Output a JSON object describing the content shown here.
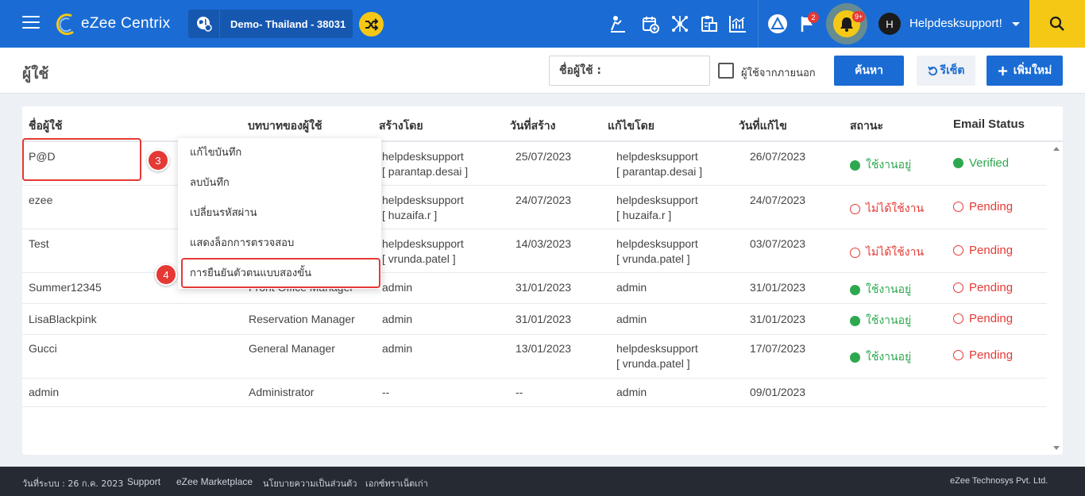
{
  "header": {
    "logo_text": "eZee Centrix",
    "property": "Demo- Thailand -  38031",
    "notif_flag_count": "2",
    "notif_bell_count": "9+",
    "avatar_letter": "H",
    "username": "Helpdesksupport!"
  },
  "page": {
    "title": "ผู้ใช้",
    "search_placeholder": "ชื่อผู้ใช้ :",
    "external_label": "ผู้ใช้จากภายนอก",
    "search_btn": "ค้นหา",
    "reset_btn": "รีเซ็ต",
    "add_btn": "เพิ่มใหม่"
  },
  "table": {
    "headers": [
      "ชื่อผู้ใช้",
      "บทบาทของผู้ใช้",
      "สร้างโดย",
      "วันที่สร้าง",
      "แก้ไขโดย",
      "วันที่แก้ไข",
      "สถานะ",
      "Email Status"
    ],
    "rows": [
      {
        "name": "P@D",
        "role": "",
        "created_by": "helpdesksupport",
        "created_by2": "[ parantap.desai ]",
        "created": "25/07/2023",
        "modified_by": "helpdesksupport",
        "modified_by2": "[ parantap.desai ]",
        "modified": "26/07/2023",
        "status": "ใช้งานอยู่",
        "email": "Verified"
      },
      {
        "name": "ezee",
        "role": "",
        "created_by": "helpdesksupport",
        "created_by2": "[ huzaifa.r ]",
        "created": "24/07/2023",
        "modified_by": "helpdesksupport",
        "modified_by2": "[ huzaifa.r ]",
        "modified": "24/07/2023",
        "status": "ไม่ได้ใช้งาน",
        "email": "Pending"
      },
      {
        "name": "Test",
        "role": "",
        "created_by": "helpdesksupport",
        "created_by2": "[ vrunda.patel ]",
        "created": "14/03/2023",
        "modified_by": "helpdesksupport",
        "modified_by2": "[ vrunda.patel ]",
        "modified": "03/07/2023",
        "status": "ไม่ได้ใช้งาน",
        "email": "Pending"
      },
      {
        "name": "Summer12345",
        "role": "Front Office Manager",
        "created_by": "admin",
        "created_by2": "",
        "created": "31/01/2023",
        "modified_by": "admin",
        "modified_by2": "",
        "modified": "31/01/2023",
        "status": "ใช้งานอยู่",
        "email": "Pending"
      },
      {
        "name": "LisaBlackpink",
        "role": "Reservation Manager",
        "created_by": "admin",
        "created_by2": "",
        "created": "31/01/2023",
        "modified_by": "admin",
        "modified_by2": "",
        "modified": "31/01/2023",
        "status": "ใช้งานอยู่",
        "email": "Pending"
      },
      {
        "name": "Gucci",
        "role": "General Manager",
        "created_by": "admin",
        "created_by2": "",
        "created": "13/01/2023",
        "modified_by": "helpdesksupport",
        "modified_by2": "[ vrunda.patel ]",
        "modified": "17/07/2023",
        "status": "ใช้งานอยู่",
        "email": "Pending"
      },
      {
        "name": "admin",
        "role": "Administrator",
        "created_by": "--",
        "created_by2": "",
        "created": "--",
        "modified_by": "admin",
        "modified_by2": "",
        "modified": "09/01/2023",
        "status": "",
        "email": ""
      }
    ]
  },
  "context_menu": {
    "items": [
      "แก้ไขบันทึก",
      "ลบบันทึก",
      "เปลี่ยนรหัสผ่าน",
      "แสดงล็อกการตรวจสอบ",
      "การยืนยันตัวตนแบบสองขั้น"
    ]
  },
  "steps": {
    "step3": "3",
    "step4": "4"
  },
  "footer": {
    "date": "วันที่ระบบ : 26 ก.ค. 2023",
    "support": "Support",
    "marketplace": "eZee Marketplace",
    "privacy": "นโยบายความเป็นส่วนตัว",
    "old_docs": "เอกซ์ทราเน็ตเก่า",
    "company": "eZee Technosys Pvt. Ltd."
  },
  "colors": {
    "primary": "#1a6cd4",
    "accent": "#f5c816",
    "active": "#2ea84f",
    "inactive": "#e53935",
    "footer_bg": "#252a33"
  }
}
